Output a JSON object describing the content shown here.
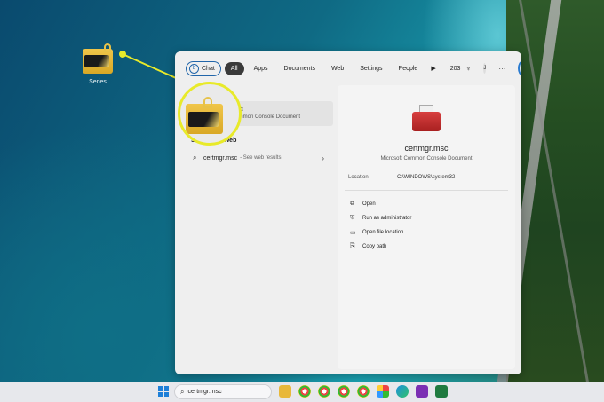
{
  "desktop": {
    "icon_label": "Series"
  },
  "search_panel": {
    "tabs": [
      {
        "label": "Chat"
      },
      {
        "label": "All"
      },
      {
        "label": "Apps"
      },
      {
        "label": "Documents"
      },
      {
        "label": "Web"
      },
      {
        "label": "Settings"
      },
      {
        "label": "People"
      }
    ],
    "play_icon": "play-icon",
    "points": "203",
    "avatar_initial": "J",
    "more_label": "···",
    "best_match": {
      "title": "msc",
      "subtitle": "Common Console Document"
    },
    "web_section_title": "Search the web",
    "web_result": {
      "query": "certmgr.msc",
      "suffix": "- See web results"
    },
    "detail": {
      "app_name": "certmgr.msc",
      "app_type": "Microsoft Common Console Document",
      "location_label": "Location",
      "location_value": "C:\\WINDOWS\\system32",
      "actions": [
        {
          "label": "Open",
          "icon": "open-external-icon"
        },
        {
          "label": "Run as administrator",
          "icon": "shield-icon"
        },
        {
          "label": "Open file location",
          "icon": "folder-icon"
        },
        {
          "label": "Copy path",
          "icon": "copy-icon"
        }
      ]
    }
  },
  "taskbar": {
    "search_text": "certmgr.msc"
  },
  "colors": {
    "highlight": "#e8ea2a",
    "accent": "#1d7fd8"
  }
}
